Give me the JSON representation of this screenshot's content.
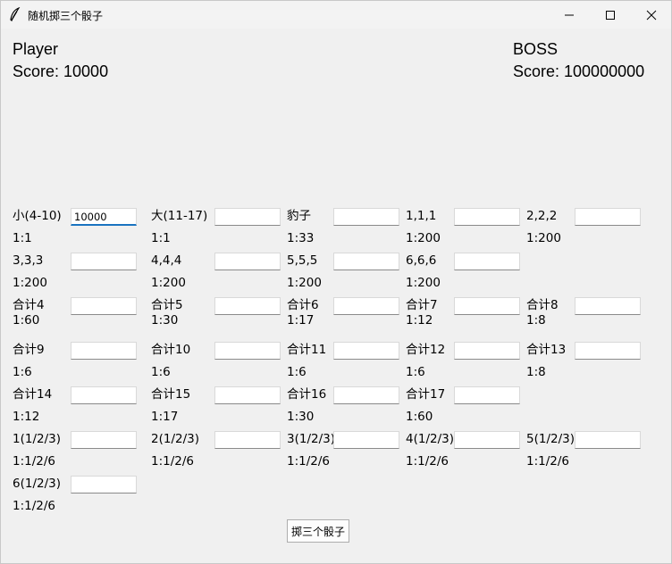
{
  "window": {
    "title": "随机掷三个骰子"
  },
  "player": {
    "name": "Player",
    "score": "Score: 10000"
  },
  "boss": {
    "name": "BOSS",
    "score": "Score: 100000000"
  },
  "bets": [
    {
      "label": "小(4-10)",
      "odds": "1:1",
      "value": "10000"
    },
    {
      "label": "大(11-17)",
      "odds": "1:1",
      "value": ""
    },
    {
      "label": "豹子",
      "odds": "1:33",
      "value": ""
    },
    {
      "label": "1,1,1",
      "odds": "1:200",
      "value": ""
    },
    {
      "label": "2,2,2",
      "odds": "1:200",
      "value": ""
    },
    {
      "label": "3,3,3",
      "odds": "1:200",
      "value": ""
    },
    {
      "label": "4,4,4",
      "odds": "1:200",
      "value": ""
    },
    {
      "label": "5,5,5",
      "odds": "1:200",
      "value": ""
    },
    {
      "label": "6,6,6",
      "odds": "1:200",
      "value": ""
    },
    {
      "label": "合计4",
      "odds": "1:60",
      "value": ""
    },
    {
      "label": "合计5",
      "odds": "1:30",
      "value": ""
    },
    {
      "label": "合计6",
      "odds": "1:17",
      "value": ""
    },
    {
      "label": "合计7",
      "odds": "1:12",
      "value": ""
    },
    {
      "label": "合计8",
      "odds": "1:8",
      "value": ""
    },
    {
      "label": "合计9",
      "odds": "1:6",
      "value": ""
    },
    {
      "label": "合计10",
      "odds": "1:6",
      "value": ""
    },
    {
      "label": "合计11",
      "odds": "1:6",
      "value": ""
    },
    {
      "label": "合计12",
      "odds": "1:6",
      "value": ""
    },
    {
      "label": "合计13",
      "odds": "1:8",
      "value": ""
    },
    {
      "label": "合计14",
      "odds": "1:12",
      "value": ""
    },
    {
      "label": "合计15",
      "odds": "1:17",
      "value": ""
    },
    {
      "label": "合计16",
      "odds": "1:30",
      "value": ""
    },
    {
      "label": "合计17",
      "odds": "1:60",
      "value": ""
    },
    {
      "label": "1(1/2/3)",
      "odds": "1:1/2/6",
      "value": ""
    },
    {
      "label": "2(1/2/3)",
      "odds": "1:1/2/6",
      "value": ""
    },
    {
      "label": "3(1/2/3)",
      "odds": "1:1/2/6",
      "value": ""
    },
    {
      "label": "4(1/2/3)",
      "odds": "1:1/2/6",
      "value": ""
    },
    {
      "label": "5(1/2/3)",
      "odds": "1:1/2/6",
      "value": ""
    },
    {
      "label": "6(1/2/3)",
      "odds": "1:1/2/6",
      "value": ""
    }
  ],
  "roll_button": {
    "label": "掷三个骰子"
  }
}
